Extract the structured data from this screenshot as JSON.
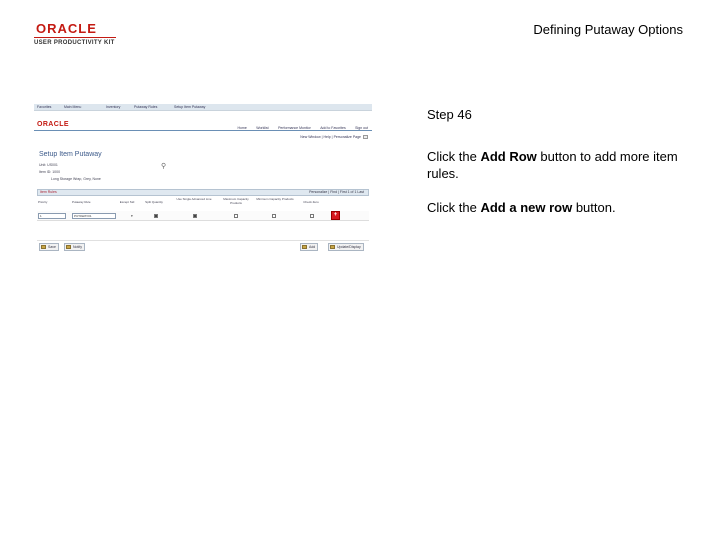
{
  "header": {
    "logo_oracle": "ORACLE",
    "logo_upk": "USER PRODUCTIVITY KIT",
    "doc_title": "Defining Putaway Options"
  },
  "thumbnail": {
    "topbar_items": [
      "Favorites",
      "Main Menu",
      "Inventory",
      "Putaway Rules",
      "Setup Item Putaway"
    ],
    "logo": "ORACLE",
    "nav_links": [
      "Home",
      "Worklist",
      "Performance Monitor",
      "Add to Favorites",
      "Sign out"
    ],
    "page_links": "New Window | Help | Personalize Page",
    "page_title": "Setup Item Putaway",
    "info_lines": [
      "Unit: US001",
      "Item ID: 1000",
      "Long Storage Wrap, Grey, None"
    ],
    "grid_label": "Item Rules",
    "grid_nav": "Personalize | Find | First 1 of 1 Last",
    "columns": [
      "Priority",
      "Putaway Rule",
      "Except Std",
      "Split Quantity",
      "Use Single Advanced Line",
      "Maximum Capacity Products",
      "Minimum Capacity Products",
      "Check Zero"
    ],
    "row": {
      "priority": "1",
      "rule": "PUTAWAY01"
    },
    "add_row_icon": "plus-icon",
    "buttons_left": [
      "Save",
      "Notify"
    ],
    "buttons_right": [
      "Add",
      "Update/Display"
    ]
  },
  "instructions": {
    "step": "Step 46",
    "line1_pre": "Click the ",
    "line1_bold": "Add Row",
    "line1_post": " button to add more item rules.",
    "line2_pre": "Click the ",
    "line2_bold": "Add a new row",
    "line2_post": " button."
  }
}
